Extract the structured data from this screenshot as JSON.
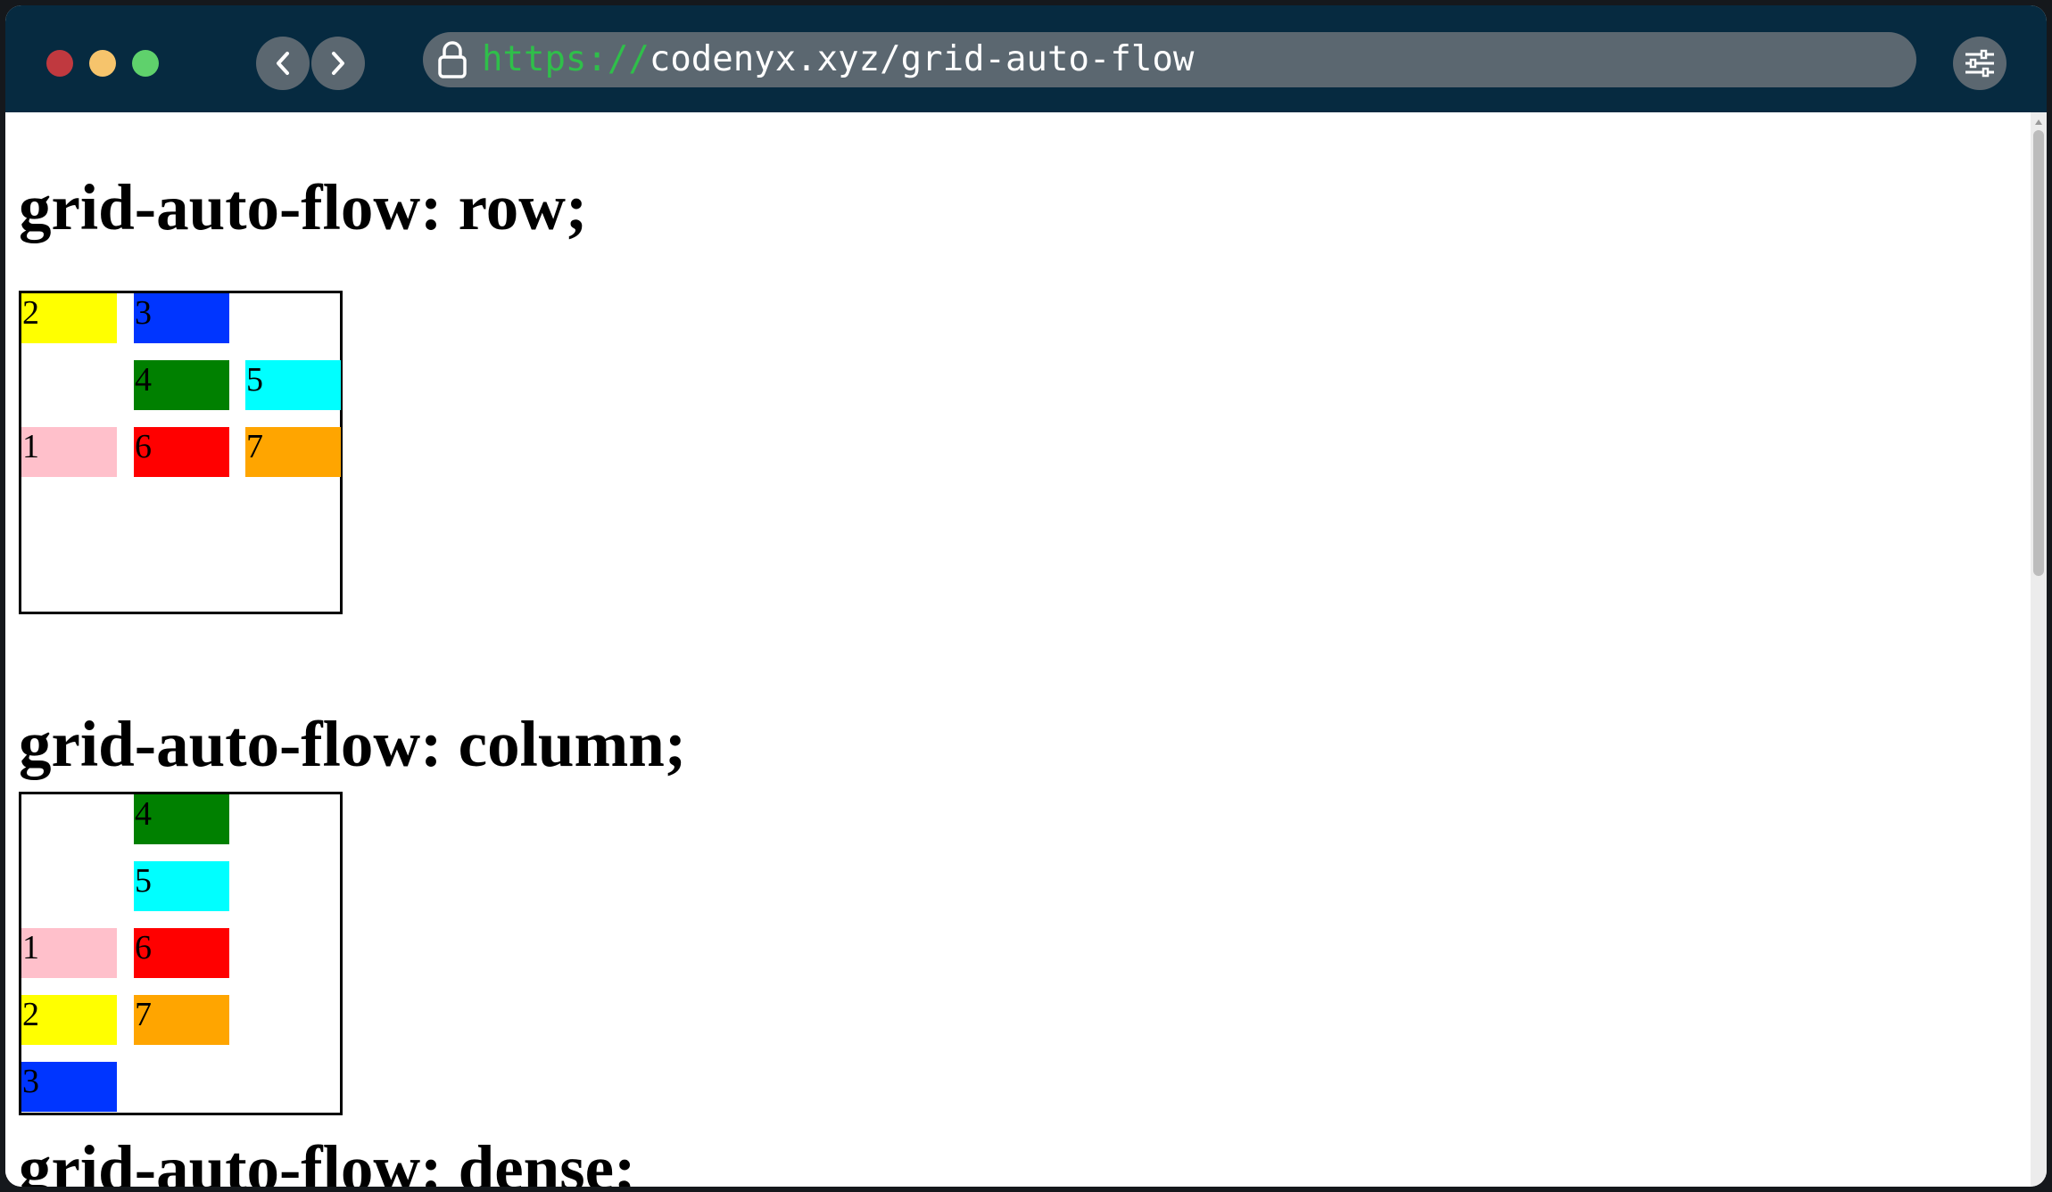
{
  "browser": {
    "url_scheme": "https://",
    "url_rest": "codenyx.xyz/grid-auto-flow",
    "colors": {
      "titlebar": "#062a40",
      "urlbar": "#5b6770",
      "scheme_text": "#2fbf4a",
      "close": "#c0393f",
      "minimize": "#f6c46c",
      "maximize": "#5fd16c"
    },
    "icons": [
      "back-icon",
      "forward-icon",
      "lock-icon",
      "settings-sliders-icon"
    ]
  },
  "sections": [
    {
      "heading": "grid-auto-flow: row;",
      "items": [
        {
          "label": "2",
          "color": "#ffff00"
        },
        {
          "label": "3",
          "color": "#0035ff"
        },
        {
          "label": "4",
          "color": "#008000"
        },
        {
          "label": "5",
          "color": "#00ffff"
        },
        {
          "label": "1",
          "color": "#ffc0cb"
        },
        {
          "label": "6",
          "color": "#ff0000"
        },
        {
          "label": "7",
          "color": "#ffa500"
        }
      ]
    },
    {
      "heading": "grid-auto-flow: column;",
      "items": [
        {
          "label": "4",
          "color": "#008000"
        },
        {
          "label": "5",
          "color": "#00ffff"
        },
        {
          "label": "1",
          "color": "#ffc0cb"
        },
        {
          "label": "6",
          "color": "#ff0000"
        },
        {
          "label": "2",
          "color": "#ffff00"
        },
        {
          "label": "7",
          "color": "#ffa500"
        },
        {
          "label": "3",
          "color": "#0035ff"
        }
      ]
    }
  ],
  "partial_heading": "grid-auto-flow: dense;"
}
